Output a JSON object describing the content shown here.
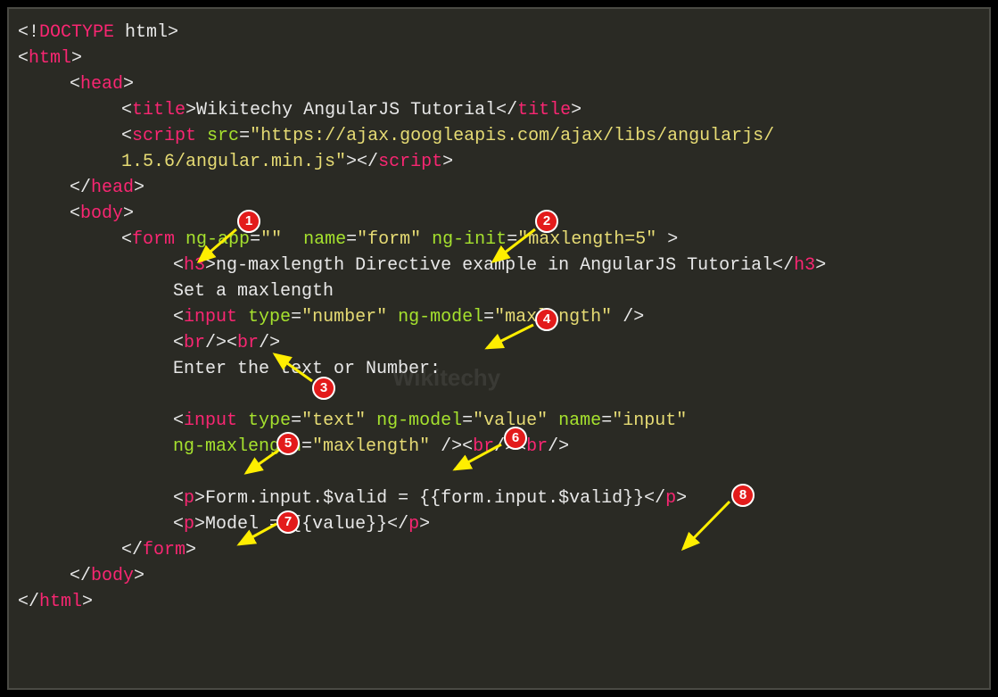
{
  "code": {
    "l1": "<!DOCTYPE html>",
    "l2_open": "html",
    "l3_open": "head",
    "l4_tag": "title",
    "l4_text": "Wikitechy AngularJS Tutorial",
    "l5_tag": "script",
    "l5_attr": "src",
    "l5_val": "\"https://ajax.googleapis.com/ajax/libs/angularjs/",
    "l6_val": "1.5.6/angular.min.js\"",
    "l7_close": "head",
    "l8_open": "body",
    "l9_tag": "form",
    "l9_a1": "ng-app",
    "l9_v1": "\"\"",
    "l9_a2": "name",
    "l9_v2": "\"form\"",
    "l9_a3": "ng-init",
    "l9_v3": "\"maxlength=5\"",
    "l10_tag": "h3",
    "l10_text": "ng-maxlength Directive example in AngularJS Tutorial",
    "l11_text": "Set a maxlength",
    "l12_tag": "input",
    "l12_a1": "type",
    "l12_v1": "\"number\"",
    "l12_a2": "ng-model",
    "l12_v2": "\"maxlength\"",
    "l13_tag": "br",
    "l14_text": "Enter the text or Number:",
    "l15_tag": "input",
    "l15_a1": "type",
    "l15_v1": "\"text\"",
    "l15_a2": "ng-model",
    "l15_v2": "\"value\"",
    "l15_a3": "name",
    "l15_v3": "\"input\"",
    "l16_a1": "ng-maxlength",
    "l16_v1": "\"maxlength\"",
    "l17_tag": "p",
    "l17_text": "Form.input.$valid = {{form.input.$valid}}",
    "l18_text": "Model = {{value}}",
    "l19_close": "form",
    "l20_close": "body",
    "l21_close": "html"
  },
  "markers": {
    "m1": "1",
    "m2": "2",
    "m3": "3",
    "m4": "4",
    "m5": "5",
    "m6": "6",
    "m7": "7",
    "m8": "8"
  },
  "watermark": "Wikitechy"
}
